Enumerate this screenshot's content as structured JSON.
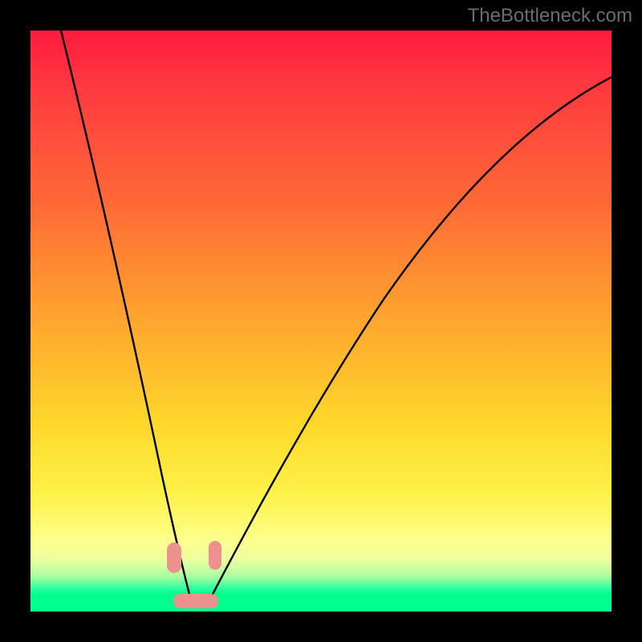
{
  "watermark": "TheBottleneck.com",
  "chart_data": {
    "type": "line",
    "title": "",
    "xlabel": "",
    "ylabel": "",
    "xlim": [
      0,
      100
    ],
    "ylim": [
      0,
      100
    ],
    "note": "Bottleneck / deviation curve. Single V-shaped curve with minimum near x≈27. Background is a vertical heat gradient (red high → green low). Axis ticks and numeric labels are not visible in the image; x/y values below are estimated from curve geometry in percent of plot area.",
    "series": [
      {
        "name": "curve",
        "x": [
          5,
          10,
          15,
          20,
          23,
          25,
          27,
          29,
          31,
          34,
          40,
          50,
          60,
          70,
          80,
          90,
          100
        ],
        "y": [
          100,
          74,
          49,
          25,
          12,
          5,
          0,
          2,
          6,
          13,
          27,
          46,
          61,
          72,
          81,
          88,
          93
        ]
      }
    ],
    "min_point": {
      "x": 27,
      "y": 0
    },
    "markers": [
      {
        "name": "left-lobe",
        "x": 25,
        "y": 6
      },
      {
        "name": "right-lobe",
        "x": 31,
        "y": 6
      },
      {
        "name": "bottom-bar",
        "x": 28,
        "y": 0.5
      }
    ]
  }
}
